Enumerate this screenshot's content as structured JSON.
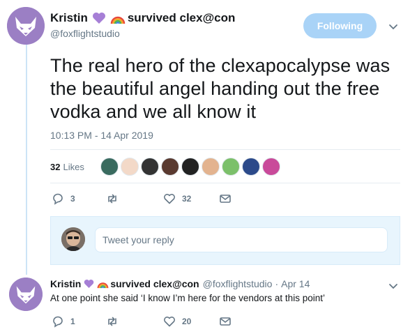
{
  "tweet": {
    "display_name": "Kristin",
    "display_name_suffix": "survived clex@con",
    "name_emojis": [
      "purple-heart",
      "rainbow"
    ],
    "handle": "@foxflightstudio",
    "follow_label": "Following",
    "text": "The real hero of the clexapocalypse was the beautiful angel handing out the free vodka and we all know it",
    "timestamp": "10:13 PM - 14 Apr 2019",
    "likes_count": "32",
    "likes_label": "Likes",
    "likers": [
      "#3a6b5f",
      "#f3d9c8",
      "#333333",
      "#5a3a30",
      "#222222",
      "#e3b38f",
      "#7cc06a",
      "#2c4a8a",
      "#c94a9a"
    ],
    "actions": {
      "replies": "3",
      "retweets": "",
      "likes": "32"
    }
  },
  "reply_box": {
    "placeholder": "Tweet your reply"
  },
  "reply": {
    "display_name": "Kristin",
    "display_name_suffix": "survived clex@con",
    "handle": "@foxflightstudio",
    "date": "Apr 14",
    "separator": "·",
    "text": "At one point she said ‘I know I’m here for the vendors at this point’",
    "actions": {
      "replies": "1",
      "retweets": "",
      "likes": "20"
    }
  },
  "colors": {
    "accent": "#1da1f2",
    "follow_button": "#a9d3f7",
    "secondary_text": "#657786",
    "reply_box_bg": "#e8f5fd",
    "avatar_purple": "#9b7fc4"
  }
}
